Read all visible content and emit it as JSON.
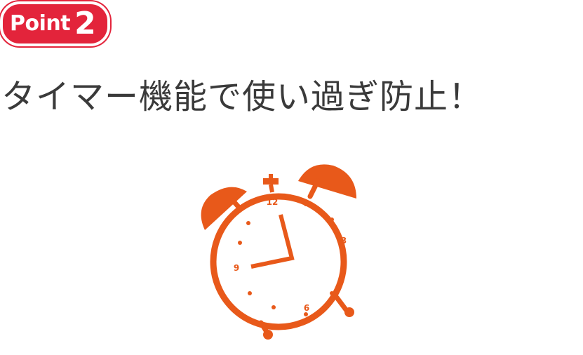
{
  "badge": {
    "word": "Point",
    "number": "2",
    "color": "#e3243b"
  },
  "headline": "タイマー機能で使い過ぎ防止！",
  "clock": {
    "icon": "alarm-clock-icon",
    "color": "#e8591a",
    "numerals": {
      "twelve": "12",
      "three": "3",
      "six": "6",
      "nine": "9"
    }
  }
}
